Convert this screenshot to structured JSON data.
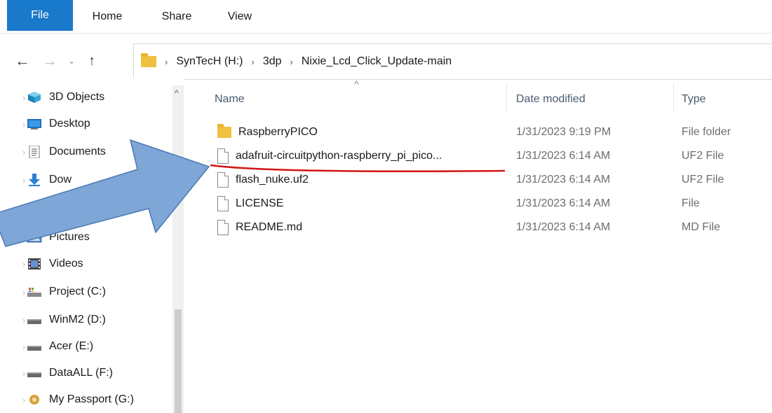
{
  "ribbon": {
    "tabs": [
      "File",
      "Home",
      "Share",
      "View"
    ]
  },
  "address": {
    "back_icon": "←",
    "forward_icon": "→",
    "recent_icon": "⌄",
    "up_icon": "↑",
    "crumbs": [
      "SynTecH (H:)",
      "3dp",
      "Nixie_Lcd_Click_Update-main"
    ],
    "separator": "›"
  },
  "sidebar": {
    "items": [
      {
        "label": "3D Objects",
        "icon": "cube-icon"
      },
      {
        "label": "Desktop",
        "icon": "desktop-icon"
      },
      {
        "label": "Documents",
        "icon": "documents-icon"
      },
      {
        "label": "Dow",
        "icon": "downloads-icon"
      },
      {
        "label": "sic",
        "icon": "music-icon"
      },
      {
        "label": "Pictures",
        "icon": "pictures-icon"
      },
      {
        "label": "Videos",
        "icon": "videos-icon"
      },
      {
        "label": "Project (C:)",
        "icon": "drive-icon"
      },
      {
        "label": "WinM2 (D:)",
        "icon": "drive-icon"
      },
      {
        "label": "Acer (E:)",
        "icon": "drive-icon"
      },
      {
        "label": "DataALL (F:)",
        "icon": "drive-icon"
      },
      {
        "label": "My Passport (G:)",
        "icon": "drive-icon"
      }
    ],
    "expand_glyph": "›",
    "scroll_up_glyph": "^"
  },
  "list": {
    "columns": {
      "name": "Name",
      "date": "Date modified",
      "type": "Type"
    },
    "sort_glyph": "^",
    "rows": [
      {
        "name": "RaspberryPICO",
        "date": "1/31/2023 9:19 PM",
        "type": "File folder",
        "kind": "folder"
      },
      {
        "name": "adafruit-circuitpython-raspberry_pi_pico...",
        "date": "1/31/2023 6:14 AM",
        "type": "UF2 File",
        "kind": "file"
      },
      {
        "name": "flash_nuke.uf2",
        "date": "1/31/2023 6:14 AM",
        "type": "UF2 File",
        "kind": "file"
      },
      {
        "name": "LICENSE",
        "date": "1/31/2023 6:14 AM",
        "type": "File",
        "kind": "file"
      },
      {
        "name": "README.md",
        "date": "1/31/2023 6:14 AM",
        "type": "MD File",
        "kind": "file"
      }
    ]
  },
  "colors": {
    "accent": "#1979ca",
    "annotation_red": "#d21414",
    "arrow_fill": "#7ea6d6"
  }
}
